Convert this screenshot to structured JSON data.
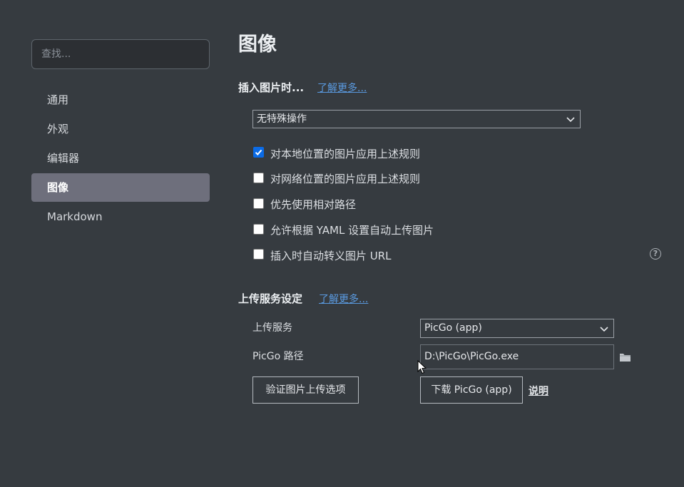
{
  "sidebar": {
    "search_placeholder": "查找...",
    "items": [
      {
        "label": "通用"
      },
      {
        "label": "外观"
      },
      {
        "label": "编辑器"
      },
      {
        "label": "图像",
        "active": true
      },
      {
        "label": "Markdown"
      }
    ]
  },
  "main": {
    "title": "图像",
    "insert_section": {
      "title": "插入图片时...",
      "learn_more": "了解更多...",
      "action_select": "无特殊操作",
      "options": [
        {
          "label": "对本地位置的图片应用上述规则",
          "checked": true
        },
        {
          "label": "对网络位置的图片应用上述规则",
          "checked": false
        },
        {
          "label": "优先使用相对路径",
          "checked": false
        },
        {
          "label": "允许根据 YAML 设置自动上传图片",
          "checked": false
        },
        {
          "label": "插入时自动转义图片 URL",
          "checked": false
        }
      ],
      "help_icon": "question-circle-icon"
    },
    "upload_section": {
      "title": "上传服务设定",
      "learn_more": "了解更多...",
      "service_label": "上传服务",
      "service_value": "PicGo (app)",
      "path_label": "PicGo 路径",
      "path_value": "D:\\PicGo\\PicGo.exe",
      "folder_icon": "folder-icon",
      "verify_button": "验证图片上传选项",
      "download_button": "下载 PicGo (app)",
      "docs_link": "说明"
    }
  },
  "colors": {
    "background": "#363b40",
    "active_nav": "#6e6f7c",
    "link": "#5a9ae0",
    "checkbox_checked": "#0b6be6"
  }
}
